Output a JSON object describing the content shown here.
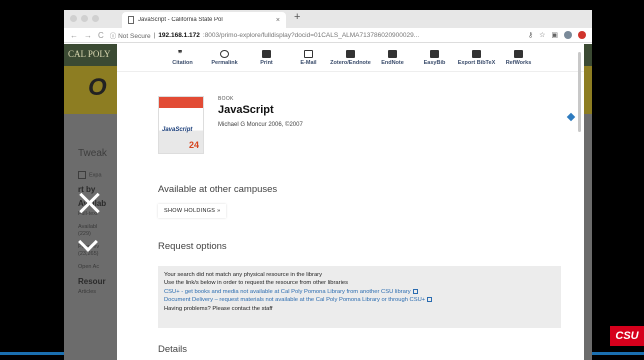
{
  "browser": {
    "tab_title": "JavaScript - California State Pol",
    "tab_close": "×",
    "new_tab": "+",
    "nav_back": "←",
    "nav_forward": "→",
    "nav_reload": "C",
    "url_security": "ⓘ Not Secure",
    "url_separator": "|",
    "url_host": "192.168.1.172",
    "url_path": ":8003/primo-explore/fulldisplay?docid=01CALS_ALMA71378602090002​9..."
  },
  "background": {
    "logo_text": "CAL POLY",
    "sidebar": {
      "tweak": "Tweak",
      "expand": "Expa",
      "sort": "rt by",
      "availability": "Availab",
      "fulltext": "Full-text",
      "available": "Availabl",
      "available_count": "(229)",
      "peer": "Peer-rev",
      "peer_count": "(23,265)",
      "open": "Open Ac",
      "resource": "Resour",
      "articles": "Articles"
    }
  },
  "actions": [
    {
      "label": "Citation",
      "icon": "quote-icon"
    },
    {
      "label": "Permalink",
      "icon": "link-icon"
    },
    {
      "label": "Print",
      "icon": "print-icon"
    },
    {
      "label": "E-Mail",
      "icon": "mail-icon"
    },
    {
      "label": "Zotero/Endnote",
      "icon": "file-icon"
    },
    {
      "label": "EndNote",
      "icon": "file-icon"
    },
    {
      "label": "EasyBib",
      "icon": "file-icon"
    },
    {
      "label": "Export BibTeX",
      "icon": "file-icon"
    },
    {
      "label": "RefWorks",
      "icon": "file-icon"
    }
  ],
  "record": {
    "type": "BOOK",
    "title": "JavaScript",
    "author": "Michael G Moncur 2006, ©2007",
    "cover_title": "JavaScript",
    "cover_number": "24"
  },
  "sections": {
    "available_other": "Available at other campuses",
    "show_holdings": "SHOW HOLDINGS »",
    "request_options": "Request options",
    "details": "Details"
  },
  "request": {
    "line1": "Your search did not match any physical resource in the library",
    "line2": "Use the link/s below in order to request the resource from other libraries",
    "link1": "CSU+ - get books and media not available at Cal Poly Pomona Library from another CSU library",
    "link2": "Document Delivery – request materials not available at the Cal Poly Pomona Library or through CSU+",
    "line3": "Having problems? Please contact the staff"
  },
  "badge": {
    "text": "CSU"
  }
}
